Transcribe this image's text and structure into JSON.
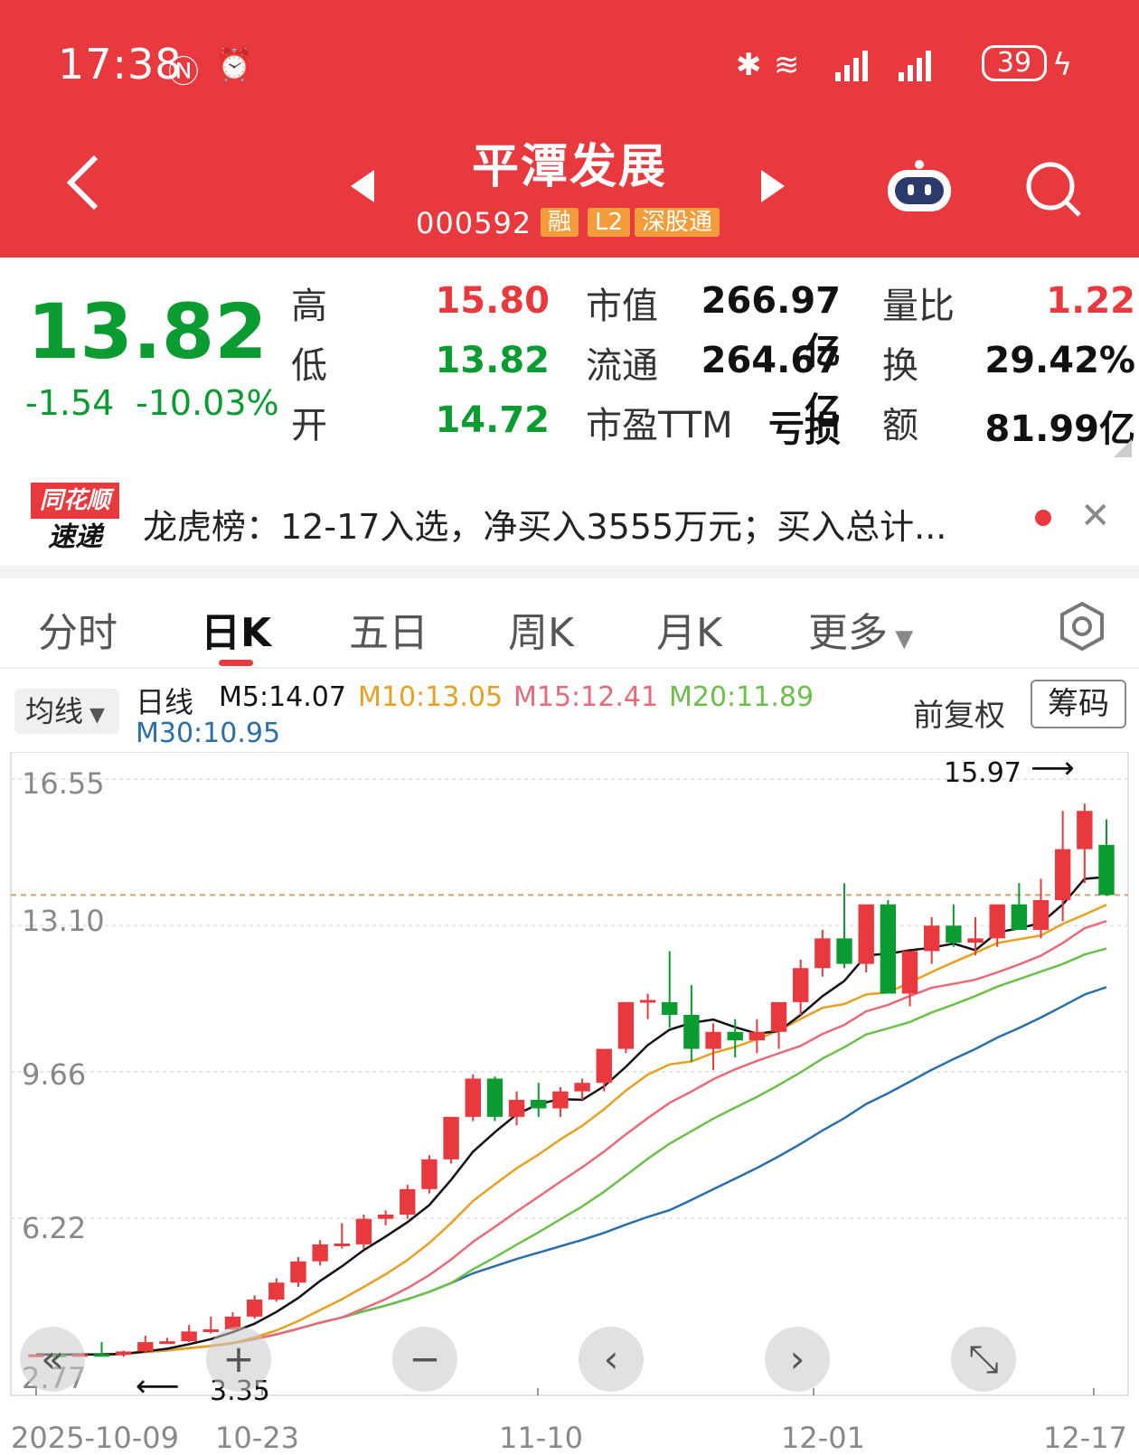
{
  "status": {
    "time": "17:38",
    "battery": "39"
  },
  "header": {
    "title": "平潭发展",
    "code": "000592",
    "badges": [
      "融",
      "L2",
      "深股通"
    ]
  },
  "quote": {
    "price": "13.82",
    "change": "-1.54",
    "change_pct": "-10.03%",
    "rows": [
      {
        "l1": "高",
        "v1": "15.80",
        "l2": "市值",
        "v2": "266.97亿",
        "l3": "量比",
        "v3": "1.22"
      },
      {
        "l1": "低",
        "v1": "13.82",
        "l2": "流通",
        "v2": "264.67亿",
        "l3": "换",
        "v3": "29.42%"
      },
      {
        "l1": "开",
        "v1": "14.72",
        "l2": "市盈TTM",
        "v2": "亏损",
        "l3": "额",
        "v3": "81.99亿"
      }
    ]
  },
  "news": {
    "logo_top": "同花顺",
    "logo_bottom": "速递",
    "text": "龙虎榜：12-17入选，净买入3555万元；买入总计..."
  },
  "tabs": [
    "分时",
    "日K",
    "五日",
    "周K",
    "月K",
    "更多"
  ],
  "ma_bar": {
    "selector": "均线",
    "type_label": "日线",
    "m5": "M5:14.07",
    "m10": "M10:13.05",
    "m15": "M15:12.41",
    "m20": "M20:11.89",
    "m30": "M30:10.95",
    "adjust": "前复权",
    "chip": "筹码"
  },
  "colors": {
    "up": "#e8393e",
    "down": "#0a9b31",
    "m5": "#111111",
    "m10": "#e8a020",
    "m15": "#e86a7a",
    "m20": "#6cc04a",
    "m30": "#2a6fa8"
  },
  "chart_data": {
    "type": "candlestick",
    "y_ticks": [
      "16.55",
      "13.10",
      "9.66",
      "6.22",
      "2.77"
    ],
    "x_labels": [
      "2025-10-09",
      "10-23",
      "11-10",
      "12-01",
      "12-17"
    ],
    "annotations": {
      "high": "15.97",
      "low": "3.35"
    },
    "candles": [
      [
        3.0,
        3.02,
        2.98,
        3.01
      ],
      [
        3.01,
        3.02,
        2.99,
        3.0
      ],
      [
        3.0,
        3.04,
        2.97,
        3.02
      ],
      [
        3.02,
        3.3,
        2.98,
        3.0
      ],
      [
        3.0,
        3.1,
        2.95,
        3.08
      ],
      [
        3.08,
        3.45,
        3.05,
        3.3
      ],
      [
        3.3,
        3.4,
        3.28,
        3.32
      ],
      [
        3.32,
        3.7,
        3.3,
        3.55
      ],
      [
        3.55,
        3.9,
        3.5,
        3.6
      ],
      [
        3.6,
        4.0,
        3.58,
        3.9
      ],
      [
        3.9,
        4.4,
        3.85,
        4.3
      ],
      [
        4.3,
        4.8,
        4.25,
        4.7
      ],
      [
        4.7,
        5.3,
        4.6,
        5.2
      ],
      [
        5.2,
        5.7,
        5.1,
        5.6
      ],
      [
        5.6,
        6.1,
        5.5,
        5.62
      ],
      [
        5.6,
        6.3,
        5.5,
        6.2
      ],
      [
        6.2,
        6.4,
        6.05,
        6.3
      ],
      [
        6.3,
        7.0,
        6.2,
        6.9
      ],
      [
        6.9,
        7.7,
        6.8,
        7.6
      ],
      [
        7.6,
        8.6,
        7.5,
        8.6
      ],
      [
        8.6,
        9.6,
        8.5,
        9.5
      ],
      [
        9.5,
        9.55,
        8.5,
        8.6
      ],
      [
        8.6,
        9.2,
        8.4,
        9.0
      ],
      [
        9.0,
        9.4,
        8.6,
        8.8
      ],
      [
        8.8,
        9.3,
        8.6,
        9.2
      ],
      [
        9.2,
        9.5,
        9.0,
        9.4
      ],
      [
        9.4,
        10.0,
        9.2,
        10.2
      ],
      [
        10.2,
        11.3,
        10.1,
        11.3
      ],
      [
        11.3,
        11.5,
        10.9,
        11.35
      ],
      [
        11.3,
        12.5,
        10.7,
        11.0
      ],
      [
        11.0,
        11.7,
        9.9,
        10.2
      ],
      [
        10.2,
        10.8,
        9.7,
        10.6
      ],
      [
        10.6,
        10.9,
        10.0,
        10.4
      ],
      [
        10.4,
        10.9,
        10.1,
        10.6
      ],
      [
        10.6,
        11.2,
        10.2,
        11.3
      ],
      [
        11.3,
        12.3,
        11.0,
        12.1
      ],
      [
        12.1,
        13.0,
        11.9,
        12.8
      ],
      [
        12.8,
        14.1,
        12.1,
        12.2
      ],
      [
        12.2,
        13.3,
        12.0,
        13.6
      ],
      [
        13.6,
        13.7,
        11.6,
        11.5
      ],
      [
        11.5,
        12.3,
        11.2,
        12.5
      ],
      [
        12.5,
        13.3,
        12.2,
        13.1
      ],
      [
        13.1,
        13.6,
        12.6,
        12.7
      ],
      [
        12.7,
        13.3,
        12.4,
        12.8
      ],
      [
        12.8,
        13.5,
        12.6,
        13.6
      ],
      [
        13.6,
        14.1,
        13.3,
        13.0
      ],
      [
        13.0,
        14.2,
        12.8,
        13.7
      ],
      [
        13.7,
        15.8,
        13.2,
        14.9
      ],
      [
        14.9,
        15.97,
        14.1,
        15.8
      ],
      [
        15.0,
        15.6,
        13.8,
        13.82
      ]
    ]
  }
}
